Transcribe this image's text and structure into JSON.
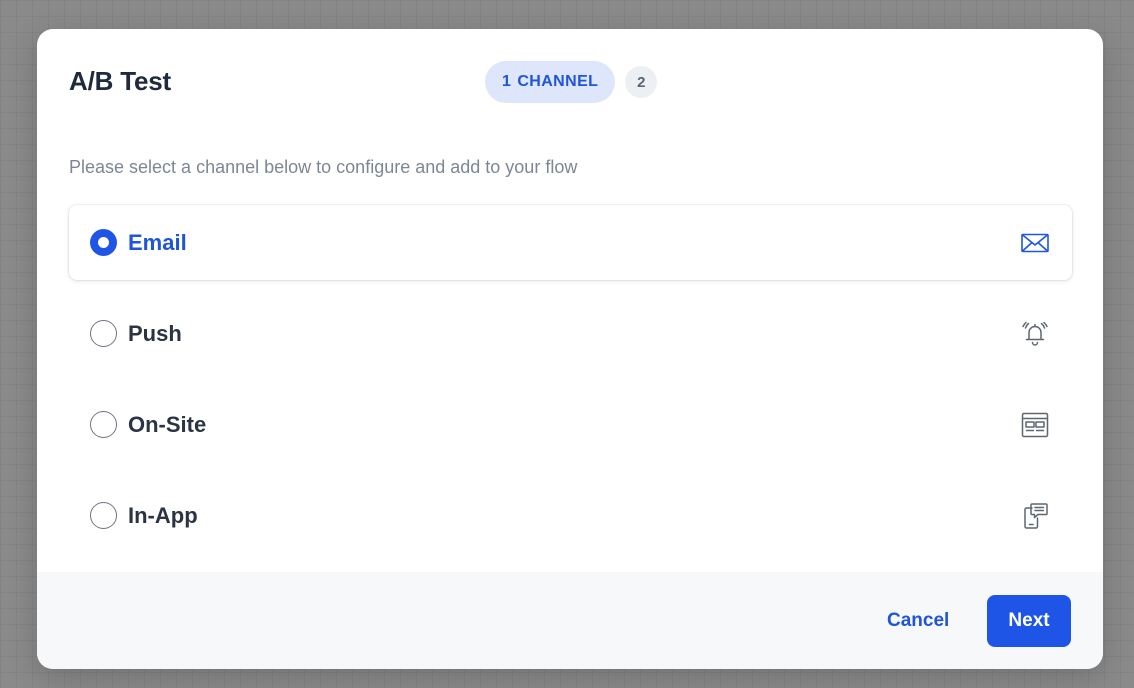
{
  "modal": {
    "title": "A/B Test",
    "steps": [
      {
        "number": "1",
        "label": "CHANNEL",
        "active": true
      },
      {
        "number": "2",
        "label": "",
        "active": false
      }
    ],
    "instruction": "Please select a channel below to configure and add to your flow"
  },
  "channels": [
    {
      "label": "Email",
      "icon": "envelope-icon",
      "selected": true
    },
    {
      "label": "Push",
      "icon": "bell-icon",
      "selected": false
    },
    {
      "label": "On-Site",
      "icon": "web-layout-icon",
      "selected": false
    },
    {
      "label": "In-App",
      "icon": "phone-message-icon",
      "selected": false
    }
  ],
  "footer": {
    "cancel_label": "Cancel",
    "next_label": "Next"
  },
  "colors": {
    "accent": "#1F55E6",
    "accent_soft": "#DDE6FB",
    "text_dark": "#1F2A3C",
    "text_muted": "#7D8794",
    "footer_bg": "#F7F8FA"
  }
}
